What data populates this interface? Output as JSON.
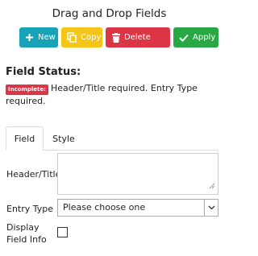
{
  "panel": {
    "title": "Drag and Drop Fields"
  },
  "toolbar": {
    "new_label": "New",
    "copy_label": "Copy",
    "delete_label": "Delete",
    "apply_label": "Apply",
    "colors": {
      "new": "#17a2b8",
      "copy": "#f5c518",
      "delete": "#dc3545",
      "apply": "#28a745"
    }
  },
  "status": {
    "heading": "Field Status:",
    "badge": "Incomplete:",
    "message": "Header/Title required. Entry Type required."
  },
  "tabs": [
    {
      "label": "Field",
      "active": true
    },
    {
      "label": "Style",
      "active": false
    }
  ],
  "form": {
    "header_title_label": "Header/Title",
    "header_title_value": "",
    "entry_type_label": "Entry Type",
    "entry_type_selected": "Please choose one",
    "display_field_info_label_line1": "Display",
    "display_field_info_label_line2": "Field Info",
    "display_field_info_checked": false
  },
  "icons": [
    "plus-icon",
    "copy-icon",
    "trash-icon",
    "check-icon",
    "chevron-down-icon",
    "resize-grip-icon"
  ]
}
